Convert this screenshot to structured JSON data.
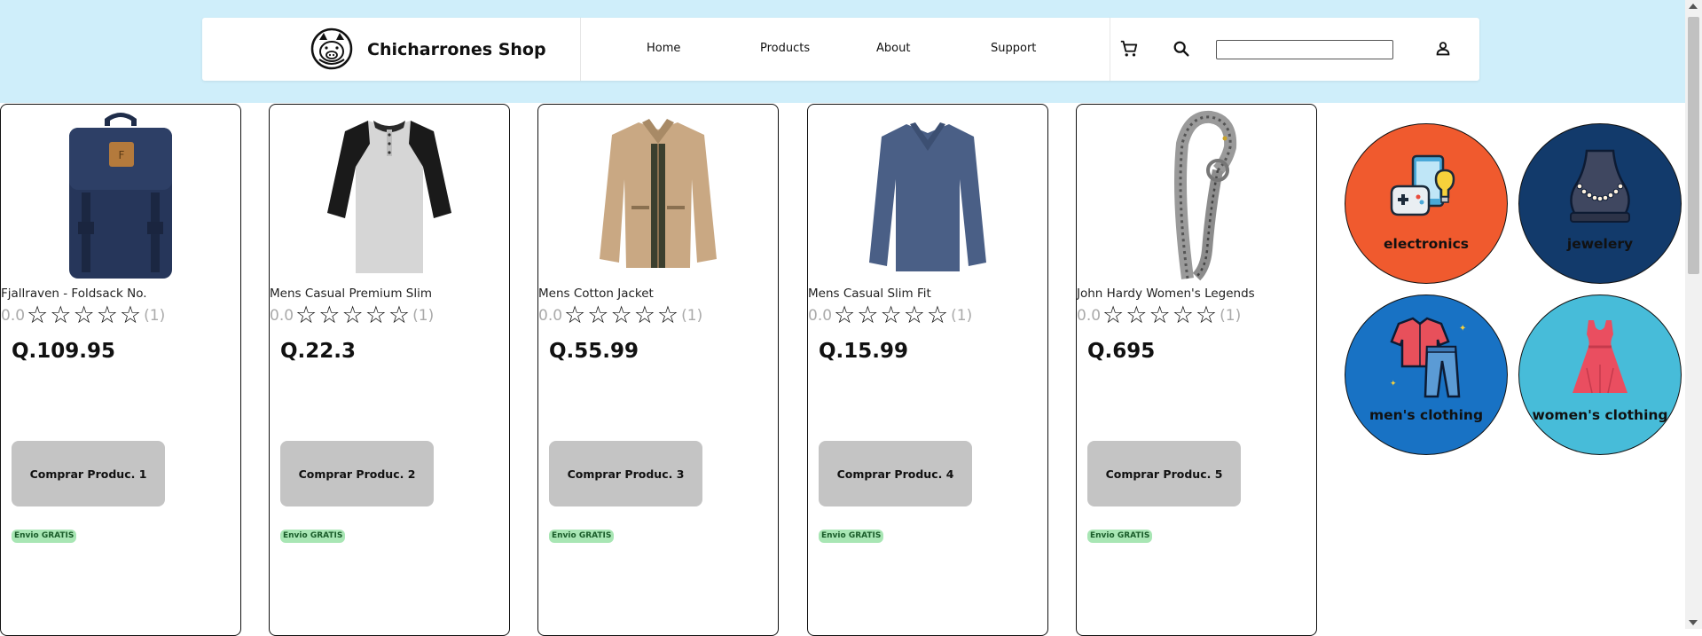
{
  "header": {
    "brand_name": "Chicharrones Shop",
    "nav": [
      "Home",
      "Products",
      "About",
      "Support"
    ],
    "search": {
      "value": "",
      "placeholder": ""
    },
    "icons": [
      "cart-icon",
      "search-icon",
      "user-icon"
    ]
  },
  "products": [
    {
      "title": "Fjallraven - Foldsack No.",
      "score": "0.0",
      "count": "(1)",
      "price": "Q.109.95",
      "button": "Comprar Produc. 1",
      "badge": "Envio GRATIS",
      "image": "backpack"
    },
    {
      "title": "Mens Casual Premium Slim",
      "score": "0.0",
      "count": "(1)",
      "price": "Q.22.3",
      "button": "Comprar Produc. 2",
      "badge": "Envio GRATIS",
      "image": "tshirt"
    },
    {
      "title": "Mens Cotton Jacket",
      "score": "0.0",
      "count": "(1)",
      "price": "Q.55.99",
      "button": "Comprar Produc. 3",
      "badge": "Envio GRATIS",
      "image": "jacket"
    },
    {
      "title": "Mens Casual Slim Fit",
      "score": "0.0",
      "count": "(1)",
      "price": "Q.15.99",
      "button": "Comprar Produc. 4",
      "badge": "Envio GRATIS",
      "image": "longsleeve"
    },
    {
      "title": "John Hardy Women's Legends",
      "score": "0.0",
      "count": "(1)",
      "price": "Q.695",
      "button": "Comprar Produc. 5",
      "badge": "Envio GRATIS",
      "image": "bracelet"
    }
  ],
  "categories": [
    {
      "label": "electronics",
      "color": "#f05a2e",
      "icon": "electronics-icon"
    },
    {
      "label": "jewelery",
      "color": "#123a6b",
      "icon": "necklace-icon"
    },
    {
      "label": "men's clothing",
      "color": "#1872c4",
      "icon": "mens-clothing-icon"
    },
    {
      "label": "women's clothing",
      "color": "#47bcd9",
      "icon": "dress-icon"
    }
  ],
  "colors": {
    "header_band": "#cfeefa",
    "button": "#c4c4c4",
    "badge": "#a8e6b4"
  }
}
